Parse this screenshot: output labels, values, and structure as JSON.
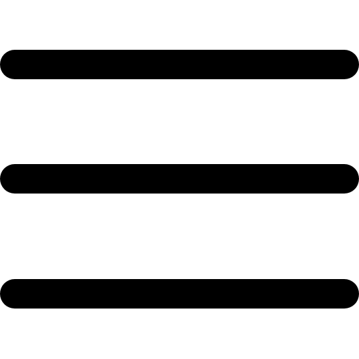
{
  "icon": {
    "name": "hamburger-menu-icon",
    "color": "#000000",
    "background": "#ffffff",
    "bar_count": 3
  }
}
